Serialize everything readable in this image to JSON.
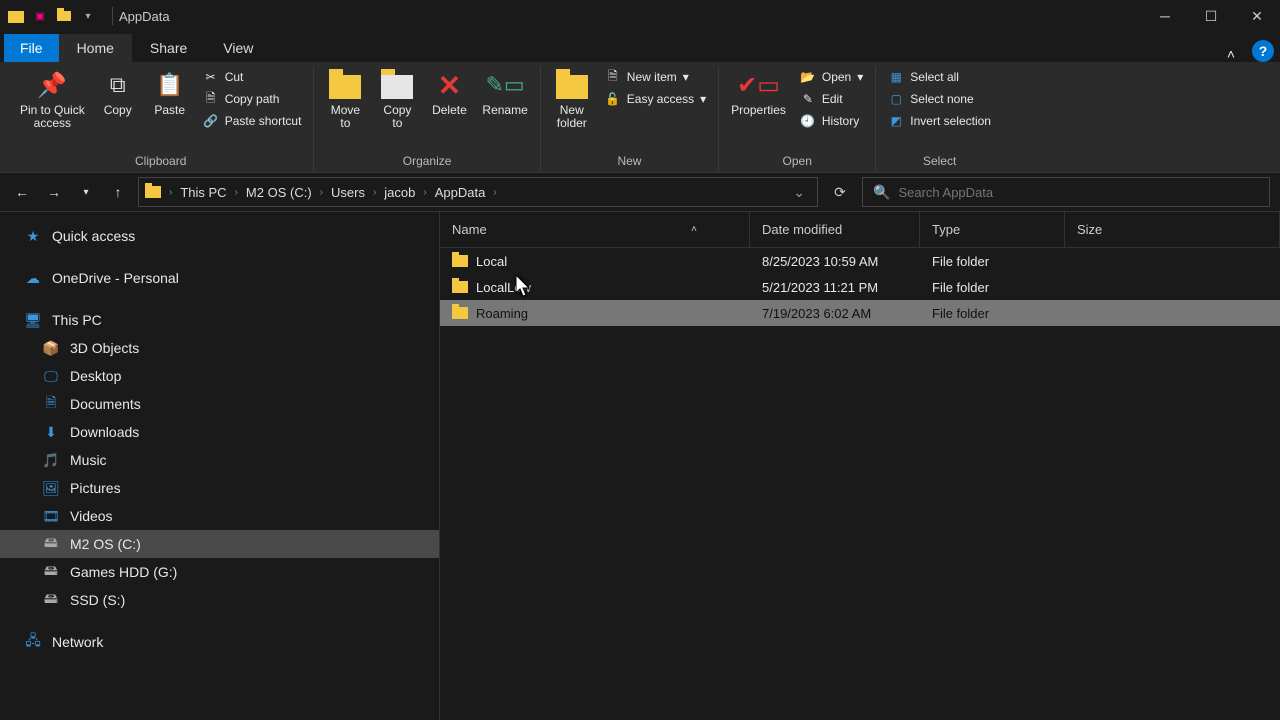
{
  "title": "AppData",
  "tabs": {
    "file": "File",
    "home": "Home",
    "share": "Share",
    "view": "View"
  },
  "ribbon": {
    "pin": "Pin to Quick\naccess",
    "copy": "Copy",
    "paste": "Paste",
    "cut": "Cut",
    "copypath": "Copy path",
    "pasteshort": "Paste shortcut",
    "clipboard_label": "Clipboard",
    "moveto": "Move\nto",
    "copyto": "Copy\nto",
    "delete": "Delete",
    "rename": "Rename",
    "organize_label": "Organize",
    "newfolder": "New\nfolder",
    "newitem": "New item",
    "easyaccess": "Easy access",
    "new_label": "New",
    "properties": "Properties",
    "open": "Open",
    "edit": "Edit",
    "history": "History",
    "open_label": "Open",
    "selectall": "Select all",
    "selectnone": "Select none",
    "invert": "Invert selection",
    "select_label": "Select"
  },
  "breadcrumbs": [
    "This PC",
    "M2 OS (C:)",
    "Users",
    "jacob",
    "AppData"
  ],
  "search_placeholder": "Search AppData",
  "tree": {
    "quick": "Quick access",
    "onedrive": "OneDrive - Personal",
    "thispc": "This PC",
    "children": [
      "3D Objects",
      "Desktop",
      "Documents",
      "Downloads",
      "Music",
      "Pictures",
      "Videos",
      "M2 OS (C:)",
      "Games HDD (G:)",
      "SSD (S:)"
    ],
    "network": "Network"
  },
  "columns": {
    "name": "Name",
    "date": "Date modified",
    "type": "Type",
    "size": "Size"
  },
  "rows": [
    {
      "name": "Local",
      "date": "8/25/2023 10:59 AM",
      "type": "File folder",
      "size": "",
      "selected": false
    },
    {
      "name": "LocalLow",
      "date": "5/21/2023 11:21 PM",
      "type": "File folder",
      "size": "",
      "selected": false
    },
    {
      "name": "Roaming",
      "date": "7/19/2023 6:02 AM",
      "type": "File folder",
      "size": "",
      "selected": true
    }
  ]
}
